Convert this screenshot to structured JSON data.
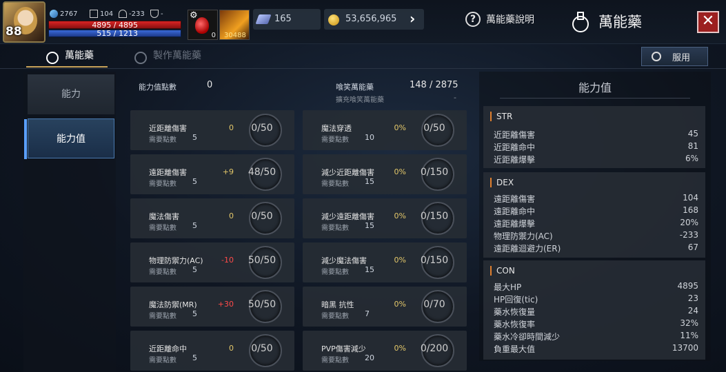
{
  "header": {
    "level": "88",
    "stats": {
      "power": "2767",
      "defense": "104",
      "ac": "-233",
      "rank": "-"
    },
    "hp_text": "4895 / 4895",
    "mp_text": "515 / 1213",
    "potion_count": "0",
    "arrow_count": "30488",
    "gem_count": "165",
    "gold_count": "53,656,965",
    "help_label": "萬能藥說明",
    "title": "萬能藥"
  },
  "tabs": [
    {
      "label": "萬能藥"
    },
    {
      "label": "製作萬能藥"
    }
  ],
  "use_button": "服用",
  "nav": [
    {
      "label": "能力"
    },
    {
      "label": "能力值"
    }
  ],
  "summary": {
    "points_label": "能力值點數",
    "points_value": "0",
    "lost_label": "喰笑萬能藥",
    "lost_value": "148 / 2875",
    "expand_label": "擴充喰笑萬能藥",
    "expand_value": "-"
  },
  "cards_left": [
    {
      "name": "近距離傷害",
      "req_label": "需要點數",
      "req": "5",
      "bonus": "0",
      "progress": "0/50"
    },
    {
      "name": "遠距離傷害",
      "req_label": "需要點數",
      "req": "5",
      "bonus": "+9",
      "progress": "48/50"
    },
    {
      "name": "魔法傷害",
      "req_label": "需要點數",
      "req": "5",
      "bonus": "0",
      "progress": "0/50"
    },
    {
      "name": "物理防禦力(AC)",
      "req_label": "需要點數",
      "req": "5",
      "bonus": "-10",
      "progress": "50/50"
    },
    {
      "name": "魔法防禦(MR)",
      "req_label": "需要點數",
      "req": "5",
      "bonus": "+30",
      "progress": "50/50"
    },
    {
      "name": "近距離命中",
      "req_label": "需要點數",
      "req": "5",
      "bonus": "0",
      "progress": "0/50"
    }
  ],
  "cards_right": [
    {
      "name": "魔法穿透",
      "req_label": "需要點數",
      "req": "10",
      "bonus": "0%",
      "progress": "0/50"
    },
    {
      "name": "減少近距離傷害",
      "req_label": "需要點數",
      "req": "15",
      "bonus": "0%",
      "progress": "0/150"
    },
    {
      "name": "減少遠距離傷害",
      "req_label": "需要點數",
      "req": "15",
      "bonus": "0%",
      "progress": "0/150"
    },
    {
      "name": "減少魔法傷害",
      "req_label": "需要點數",
      "req": "15",
      "bonus": "0%",
      "progress": "0/150"
    },
    {
      "name": "暗黑 抗性",
      "req_label": "需要點數",
      "req": "7",
      "bonus": "0%",
      "progress": "0/70"
    },
    {
      "name": "PVP傷害減少",
      "req_label": "需要點數",
      "req": "20",
      "bonus": "0%",
      "progress": "0/200"
    }
  ],
  "panel": {
    "title": "能力值",
    "groups": [
      {
        "head": "STR",
        "rows": [
          {
            "label": "近距離傷害",
            "value": "45"
          },
          {
            "label": "近距離命中",
            "value": "81"
          },
          {
            "label": "近距離爆擊",
            "value": "6%"
          }
        ]
      },
      {
        "head": "DEX",
        "rows": [
          {
            "label": "遠距離傷害",
            "value": "104"
          },
          {
            "label": "遠距離命中",
            "value": "168"
          },
          {
            "label": "遠距離爆擊",
            "value": "20%"
          },
          {
            "label": "物理防禦力(AC)",
            "value": "-233"
          },
          {
            "label": "遠距離迴避力(ER)",
            "value": "67"
          }
        ]
      },
      {
        "head": "CON",
        "rows": [
          {
            "label": "最大HP",
            "value": "4895"
          },
          {
            "label": "HP回復(tic)",
            "value": "23"
          },
          {
            "label": "藥水恢復量",
            "value": "24"
          },
          {
            "label": "藥水恢復率",
            "value": "32%"
          },
          {
            "label": "藥水冷卻時間減少",
            "value": "11%"
          },
          {
            "label": "負重最大值",
            "value": "13700"
          }
        ]
      }
    ]
  },
  "colors": {
    "accent_gold": "#c9a35a",
    "hp_red": "#d92424",
    "mp_blue": "#3a6ad8",
    "close_red": "#9c2020",
    "bonus_yellow": "#e4c86a",
    "bonus_red": "#ff4a4a"
  }
}
